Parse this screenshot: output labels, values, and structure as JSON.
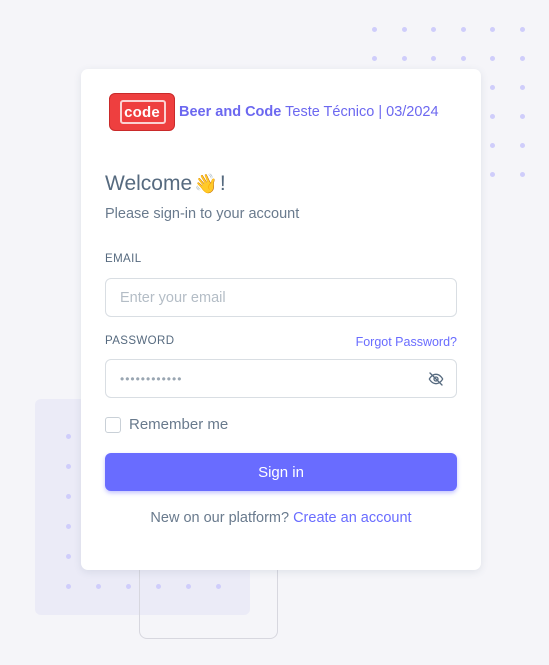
{
  "brand": {
    "logo_text": "code",
    "name": "Beer and Code",
    "tagline": "Teste Técnico | 03/2024"
  },
  "welcome": {
    "title": "Welcome",
    "wave_emoji": "👋",
    "exclaim": "!",
    "subtitle": "Please sign-in to your account"
  },
  "form": {
    "email_label": "EMAIL",
    "email_placeholder": "Enter your email",
    "email_value": "",
    "password_label": "PASSWORD",
    "password_value": "••••••••••••",
    "forgot_label": "Forgot Password?",
    "toggle_icon": "eye-off-icon",
    "remember_label": "Remember me",
    "remember_checked": false,
    "signin_label": "Sign in"
  },
  "footer": {
    "prompt": "New on our platform?",
    "create_label": "Create an account"
  },
  "colors": {
    "primary": "#696cff",
    "logo_red": "#ee3f3f",
    "background": "#f5f5f9",
    "text": "#566a7f"
  }
}
